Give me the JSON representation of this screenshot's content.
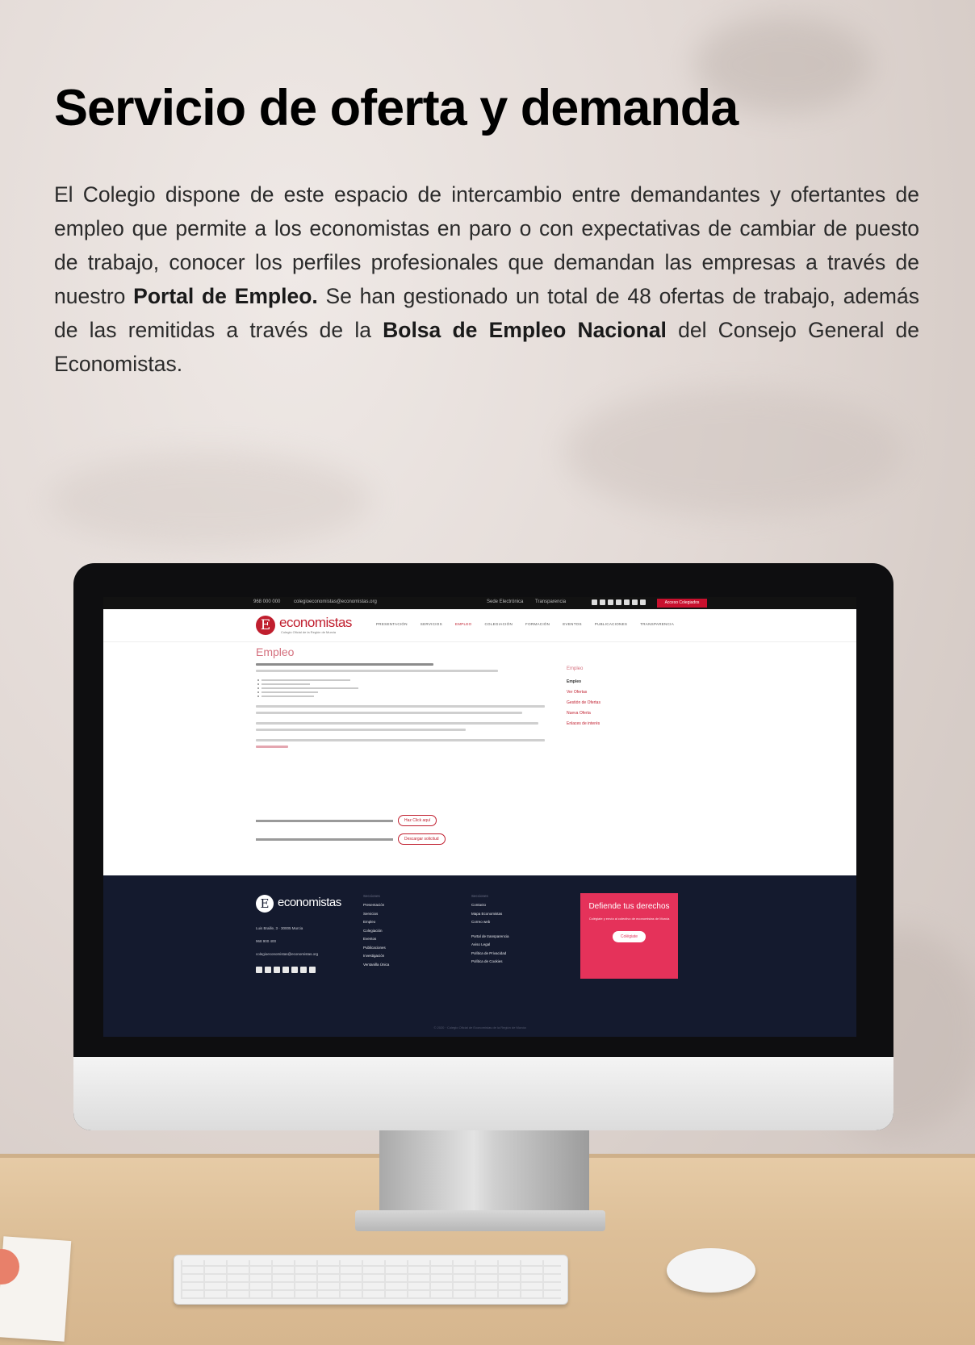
{
  "heading": "Servicio de oferta y demanda",
  "body": {
    "p1": "El Colegio dispone de este espacio de intercambio entre demandantes y ofertantes de empleo que permite a los economistas en paro o con expectativas de cambiar de puesto de trabajo, conocer los perfiles profesionales que demandan las empresas a través de nuestro ",
    "bold1": "Portal de Empleo.",
    "p2": " Se han gestionado un total de 48 ofertas de trabajo, además de las remitidas a través de la ",
    "bold2": "Bolsa de Empleo Nacional",
    "p3": " del Consejo General de Economistas."
  },
  "site": {
    "topbar": {
      "phone": "968 000 000",
      "email": "colegioeconomistas@economistas.org",
      "link_a": "Sede Electrónica",
      "link_b": "Transparencia",
      "cta": "Acceso Colegiados"
    },
    "logo": {
      "mark": "E",
      "name": "economistas",
      "tagline": "Colegio Oficial de la Región de Murcia"
    },
    "nav": [
      "PRESENTACIÓN",
      "SERVICIOS",
      "EMPLEO",
      "COLEGIACIÓN",
      "FORMACIÓN",
      "EVENTOS",
      "PUBLICACIONES",
      "TRANSPARENCIA"
    ],
    "page_title": "Empleo",
    "sidebar": {
      "heading": "Empleo",
      "items": [
        "Empleo",
        "Ver Ofertas",
        "Gestión de Ofertas",
        "Nueva Oferta",
        "Enlaces de interés"
      ]
    },
    "buttons": {
      "find_here": "Haz Click aquí",
      "download": "Descargar solicitud"
    },
    "footer": {
      "logo_name": "economistas",
      "address": "Luis Braille, 3 · 30005 Murcia",
      "phone": "968 900 400",
      "email": "colegioeconomistas@economistas.org",
      "col1_heading": "Secciones",
      "col1": [
        "Presentación",
        "Servicios",
        "Empleo",
        "Colegiación",
        "Eventos",
        "Publicaciones",
        "Investigación",
        "Ventanilla Única"
      ],
      "col2_heading": "Secciones",
      "col2a": [
        "Contacto",
        "Mapa Economistas",
        "Correo web"
      ],
      "col2b": [
        "Portal de transparencia",
        "Aviso Legal",
        "Política de Privacidad",
        "Política de Cookies"
      ],
      "cta_heading": "Defiende tus derechos",
      "cta_text": "Colégiate y envía al colectivo de economistas de Murcia",
      "cta_button": "Colégiate",
      "copyright": "© 2020 · Colegio Oficial de Economistas de la Región de Murcia"
    }
  }
}
